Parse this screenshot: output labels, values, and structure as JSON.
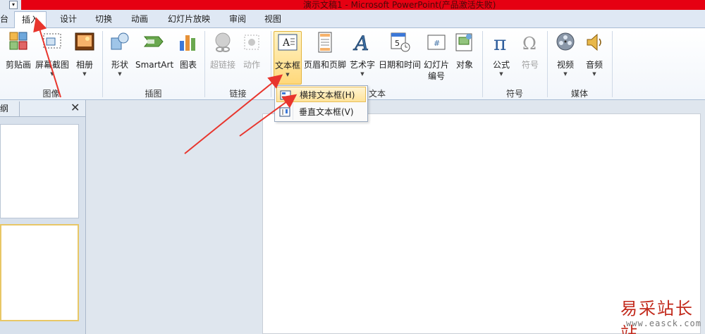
{
  "titlebar": {
    "title": "演示文稿1 - Microsoft PowerPoint(产品激活失败)",
    "qa_dropdown": "▾"
  },
  "tabs": [
    {
      "label": "台"
    },
    {
      "label": "插入",
      "active": true
    },
    {
      "label": "设计"
    },
    {
      "label": "切换"
    },
    {
      "label": "动画"
    },
    {
      "label": "幻灯片放映"
    },
    {
      "label": "审阅"
    },
    {
      "label": "视图"
    }
  ],
  "ribbon": {
    "groups": {
      "image": "图像",
      "illustrations": "插图",
      "links": "链接",
      "text": "文本",
      "symbols": "符号",
      "media": "媒体"
    },
    "buttons": {
      "clipart": "剪贴画",
      "screenshot": "屏幕截图",
      "album": "相册",
      "shapes": "形状",
      "smartart": "SmartArt",
      "chart": "图表",
      "hyperlink": "超链接",
      "action": "动作",
      "textbox": "文本框",
      "header_footer": "页眉和页脚",
      "wordart": "艺术字",
      "datetime": "日期和时间",
      "slide_number_1": "幻灯片",
      "slide_number_2": "编号",
      "object": "对象",
      "equation": "公式",
      "symbol": "符号",
      "video": "视频",
      "audio": "音频"
    },
    "icons": {
      "clipart": "clipart-icon",
      "screenshot": "screenshot-icon",
      "album": "photo-album-icon",
      "shapes": "shapes-icon",
      "smartart": "smartart-icon",
      "chart": "chart-icon",
      "hyperlink": "hyperlink-icon",
      "action": "action-icon",
      "textbox": "textbox-icon",
      "header_footer": "header-footer-icon",
      "wordart": "wordart-icon",
      "datetime": "date-time-icon",
      "slide_number": "slide-number-icon",
      "object": "object-icon",
      "equation": "pi-icon",
      "symbol": "omega-icon",
      "video": "film-reel-icon",
      "audio": "speaker-icon"
    }
  },
  "dropdown": {
    "items": [
      {
        "label": "横排文本框(H)",
        "highlighted": true
      },
      {
        "label": "垂直文本框(V)",
        "highlighted": false
      }
    ]
  },
  "left_panel": {
    "tab_fragment": "纲",
    "close_glyph": "✕"
  },
  "watermark": {
    "text": "易采站长站",
    "url": "www.easck.com"
  },
  "colors": {
    "titlebar": "#e60012",
    "selected_button": "#ffd87a",
    "arrow": "#e8352d"
  }
}
